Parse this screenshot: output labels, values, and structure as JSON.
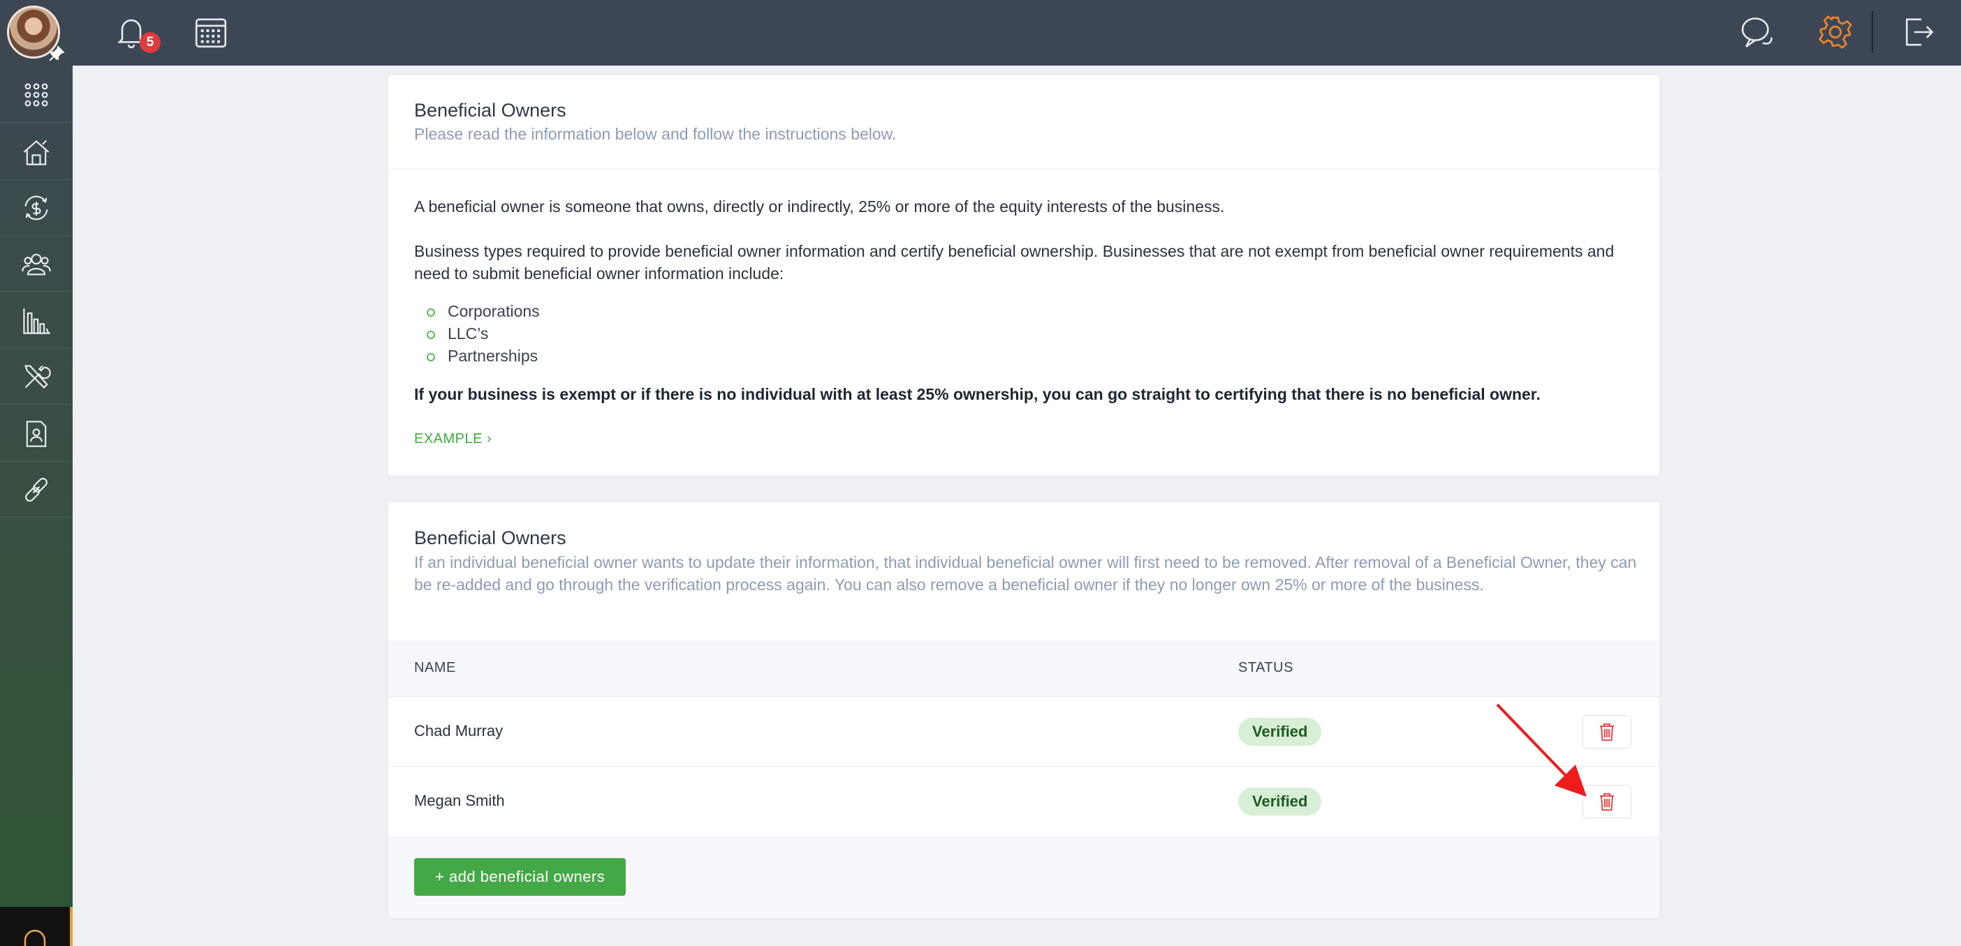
{
  "topbar": {
    "notifications_count": "5"
  },
  "intro": {
    "title": "Beneficial Owners",
    "subtitle": "Please read the information below and follow the instructions below.",
    "paragraph1": "A beneficial owner is someone that owns, directly or indirectly, 25% or more of the equity interests of the business.",
    "paragraph2": "Business types required to provide beneficial owner information and certify beneficial ownership. Businesses that are not exempt from beneficial owner requirements and need to submit beneficial owner information include:",
    "business_types": [
      "Corporations",
      "LLC’s",
      "Partnerships"
    ],
    "bold_note": "If your business is exempt or if there is no individual with at least 25% ownership, you can go straight to certifying that there is no beneficial owner.",
    "example_link": "EXAMPLE ›"
  },
  "owners": {
    "title": "Beneficial Owners",
    "description": "If an individual beneficial owner wants to update their information, that individual beneficial owner will first need to be removed. After removal of a Beneficial Owner, they can be re-added and go through the verification process again. You can also remove a beneficial owner if they no longer own 25% or more of the business.",
    "columns": {
      "name": "NAME",
      "status": "STATUS"
    },
    "rows": [
      {
        "name": "Chad Murray",
        "status": "Verified"
      },
      {
        "name": "Megan Smith",
        "status": "Verified"
      }
    ],
    "add_button": "+ add beneficial owners"
  },
  "colors": {
    "accent_green": "#45a846",
    "topbar": "#3c4654",
    "delete_red": "#e0393e",
    "settings_orange": "#e8822e"
  }
}
